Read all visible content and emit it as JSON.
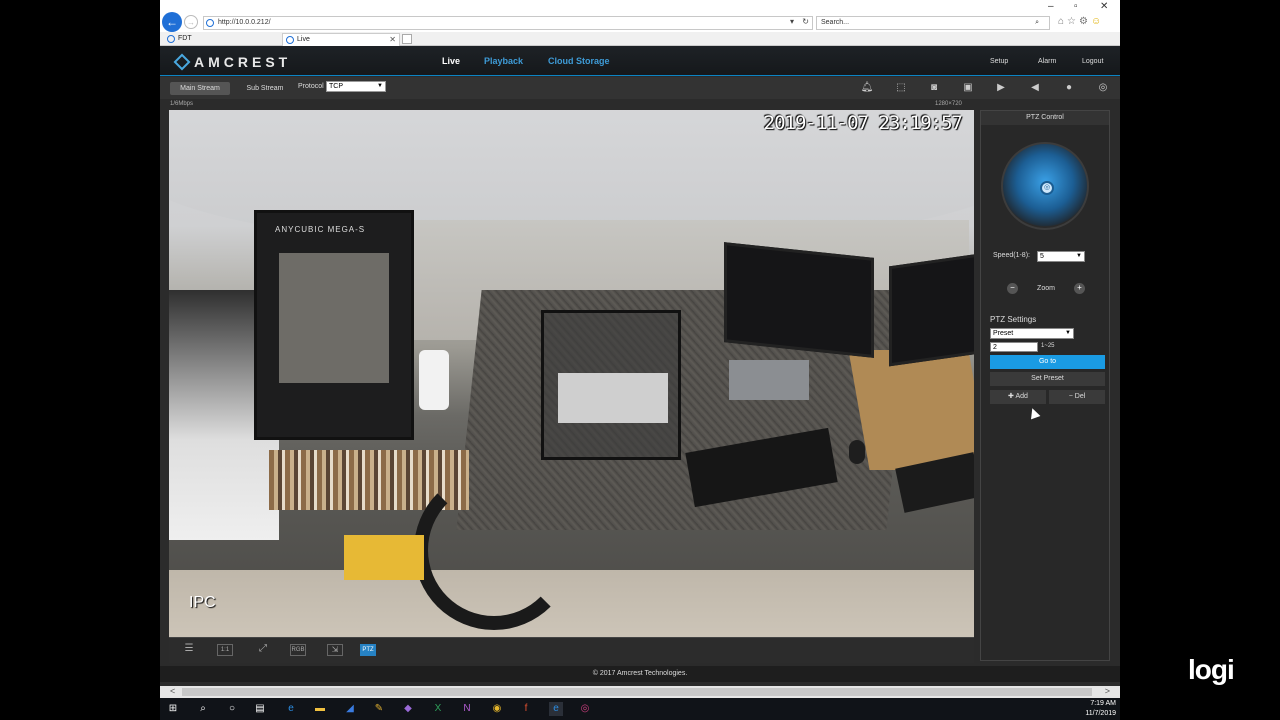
{
  "browser": {
    "url": "http://10.0.0.212/",
    "search_placeholder": "Search...",
    "tabs": [
      {
        "label": "FDT"
      },
      {
        "label": "Live"
      }
    ]
  },
  "app": {
    "logo": "AMCREST",
    "nav": {
      "live": "Live",
      "playback": "Playback",
      "cloud": "Cloud Storage",
      "setup": "Setup",
      "alarm": "Alarm",
      "logout": "Logout"
    },
    "toolbar": {
      "main_stream": "Main Stream",
      "sub_stream": "Sub Stream",
      "protocol_label": "Protocol",
      "protocol_value": "TCP"
    },
    "bitrate": "1/6Mbps",
    "resolution": "1280×720",
    "video": {
      "timestamp": "2019-11-07 23:19:57",
      "camera_name": "IPC",
      "printer_brand": "ANYCUBIC MEGA-S"
    },
    "video_controls": [
      "",
      "1:1",
      "",
      "RGB",
      "",
      "PTZ"
    ],
    "ptz": {
      "title": "PTZ Control",
      "speed_label": "Speed(1-8):",
      "speed_value": "5",
      "zoom_label": "Zoom",
      "settings_label": "PTZ Settings",
      "preset_value": "Preset",
      "preset_number": "2",
      "preset_range": "1~25",
      "goto_label": "Go to",
      "set_preset_label": "Set Preset",
      "add_label": "Add",
      "del_label": "Del"
    },
    "footer": "© 2017 Amcrest Technologies."
  },
  "taskbar": {
    "time": "7:19 AM",
    "date": "11/7/2019"
  },
  "watermark": "logi",
  "colors": {
    "accent": "#1a9be3",
    "header": "#15181b",
    "panel": "#282828"
  }
}
